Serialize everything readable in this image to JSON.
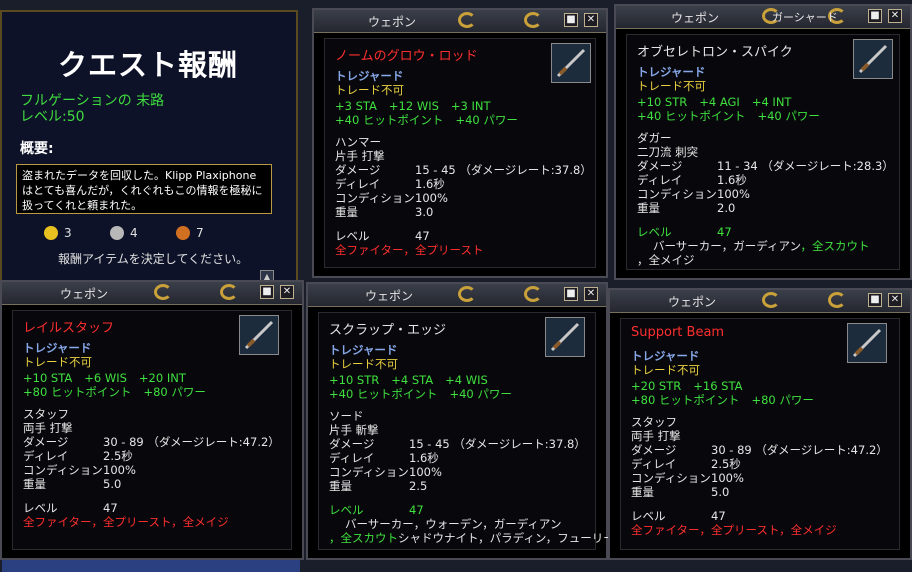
{
  "quest": {
    "title": "クエスト報酬",
    "name": "フルゲーションの 末路",
    "level": "レベル:50",
    "summary_label": "概要:",
    "summary": "盗まれたデータを回収した。Klipp Plaxiphoneはとても喜んだが，くれぐれもこの情報を極秘に扱ってくれと頼まれた。",
    "coins": [
      {
        "icon": "gold-coin-icon",
        "value": "3",
        "color": "#e8c020"
      },
      {
        "icon": "silver-coin-icon",
        "value": "4",
        "color": "#b8b8b8"
      },
      {
        "icon": "copper-coin-icon",
        "value": "7",
        "color": "#d07020"
      }
    ],
    "decide_text": "報酬アイテムを決定してください。"
  },
  "windows": [
    {
      "title": "ウェポン",
      "title_overlap": "",
      "item_name": "ノームのグロウ・ロッド",
      "item_color": "#ff2e2e",
      "type1": "トレジャード",
      "type2": "トレード不可",
      "stats1": [
        "+3 STA",
        "+12 WIS",
        "+3 INT"
      ],
      "stats2": [
        "+40 ヒットポイント",
        "+40 パワー"
      ],
      "category": "ハンマー",
      "hand": "片手 打撃",
      "props": [
        [
          "ダメージ",
          "15 - 45 （ダメージレート:37.8）"
        ],
        [
          "ディレイ",
          "1.6秒"
        ],
        [
          "コンディション",
          "100%"
        ],
        [
          "重量",
          "3.0"
        ]
      ],
      "level_label": "レベル",
      "level_value": "47",
      "level_green": false,
      "classes": [
        {
          "text": "全ファイター",
          "color": "red"
        },
        {
          "text": "，全プリースト",
          "color": "red"
        }
      ],
      "classes2": []
    },
    {
      "title": "ウェポン",
      "title_overlap": "ガーシャード",
      "item_name": "オブセレトロン・スパイク",
      "item_color": "#e6e6e6",
      "type1": "トレジャード",
      "type2": "トレード不可",
      "stats1": [
        "+10 STR",
        "+4 AGI",
        "+4 INT"
      ],
      "stats2": [
        "+40 ヒットポイント",
        "+40 パワー"
      ],
      "category": "ダガー",
      "hand": "二刀流 刺突",
      "props": [
        [
          "ダメージ",
          "11 - 34 （ダメージレート:28.3）"
        ],
        [
          "ディレイ",
          "1.6秒"
        ],
        [
          "コンディション",
          "100%"
        ],
        [
          "重量",
          "2.0"
        ]
      ],
      "level_label": "レベル",
      "level_value": "47",
      "level_green": true,
      "classes": [
        {
          "text": "バーサーカー",
          "color": "white"
        },
        {
          "text": "，ガーディアン",
          "color": "white"
        },
        {
          "text": "，全スカウト",
          "color": "green"
        }
      ],
      "classes2": [
        {
          "text": "，全メイジ",
          "color": "white"
        }
      ]
    },
    {
      "title": "ウェポン",
      "title_overlap": "",
      "item_name": "レイルスタッフ",
      "item_color": "#ff2e2e",
      "type1": "トレジャード",
      "type2": "トレード不可",
      "stats1": [
        "+10 STA",
        "+6 WIS",
        "+20 INT"
      ],
      "stats2": [
        "+80 ヒットポイント",
        "+80 パワー"
      ],
      "category": "スタッフ",
      "hand": "両手 打撃",
      "props": [
        [
          "ダメージ",
          "30 - 89 （ダメージレート:47.2）"
        ],
        [
          "ディレイ",
          "2.5秒"
        ],
        [
          "コンディション",
          "100%"
        ],
        [
          "重量",
          "5.0"
        ]
      ],
      "level_label": "レベル",
      "level_value": "47",
      "level_green": false,
      "classes": [
        {
          "text": "全ファイター",
          "color": "red"
        },
        {
          "text": "，全プリースト",
          "color": "red"
        },
        {
          "text": "，全メイジ",
          "color": "red"
        }
      ],
      "classes2": []
    },
    {
      "title": "ウェポン",
      "title_overlap": "",
      "item_name": "スクラップ・エッジ",
      "item_color": "#e6e6e6",
      "type1": "トレジャード",
      "type2": "トレード不可",
      "stats1": [
        "+10 STR",
        "+4 STA",
        "+4 WIS"
      ],
      "stats2": [
        "+40 ヒットポイント",
        "+40 パワー"
      ],
      "category": "ソード",
      "hand": "片手 斬撃",
      "props": [
        [
          "ダメージ",
          "15 - 45 （ダメージレート:37.8）"
        ],
        [
          "ディレイ",
          "1.6秒"
        ],
        [
          "コンディション",
          "100%"
        ],
        [
          "重量",
          "2.5"
        ]
      ],
      "level_label": "レベル",
      "level_value": "47",
      "level_green": true,
      "classes": [
        {
          "text": "バーサーカー",
          "color": "white"
        },
        {
          "text": "，ウォーデン",
          "color": "white"
        },
        {
          "text": "，ガーディアン",
          "color": "white"
        }
      ],
      "classes2": [
        {
          "text": "，全スカウト",
          "color": "green"
        },
        {
          "text": "シャドウナイト",
          "color": "white"
        },
        {
          "text": "，パラディン",
          "color": "white"
        },
        {
          "text": "，フューリー",
          "color": "white"
        }
      ]
    },
    {
      "title": "ウェポン",
      "title_overlap": "",
      "item_name": "Support Beam",
      "item_color": "#ff2e2e",
      "type1": "トレジャード",
      "type2": "トレード不可",
      "stats1": [
        "+20 STR",
        "+16 STA"
      ],
      "stats2": [
        "+80 ヒットポイント",
        "+80 パワー"
      ],
      "category": "スタッフ",
      "hand": "両手 打撃",
      "props": [
        [
          "ダメージ",
          "30 - 89 （ダメージレート:47.2）"
        ],
        [
          "ディレイ",
          "2.5秒"
        ],
        [
          "コンディション",
          "100%"
        ],
        [
          "重量",
          "5.0"
        ]
      ],
      "level_label": "レベル",
      "level_value": "47",
      "level_green": false,
      "classes": [
        {
          "text": "全ファイター",
          "color": "red"
        },
        {
          "text": "，全プリースト",
          "color": "red"
        },
        {
          "text": "，全メイジ",
          "color": "red"
        }
      ],
      "classes2": []
    }
  ],
  "buttons": {
    "minimize": "■",
    "close": "✕"
  }
}
